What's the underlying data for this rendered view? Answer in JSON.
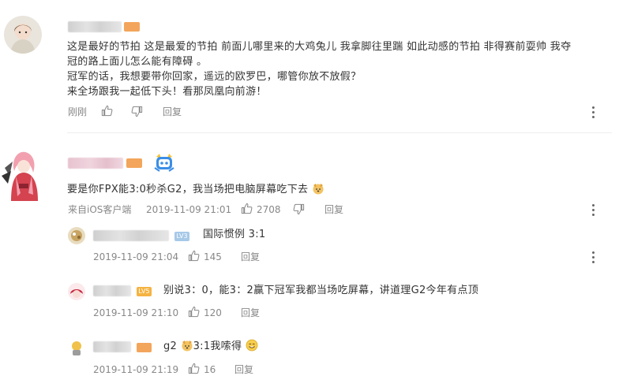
{
  "comments": [
    {
      "text_lines": [
        "这是最好的节拍 这是最爱的节拍 前面儿哪里来的大鸡兔儿 我拿脚往里踹 如此动感的节拍 非得赛前耍帅 我夺",
        "冠的路上面儿怎么能有障碍 。",
        "冠军的话，我想要带你回家，遥远的欧罗巴，哪管你放不放假？",
        "来全场跟我一起低下头！看那凤凰向前游！"
      ],
      "time": "刚刚",
      "like_count": "",
      "reply_label": "回复"
    },
    {
      "text": "要是你FPX能3:0秒杀G2，我当场把电脑屏幕吃下去",
      "source": "来自iOS客户端",
      "time": "2019-11-09 21:01",
      "like_count": "2708",
      "reply_label": "回复"
    }
  ],
  "replies": [
    {
      "badge": "LV3",
      "text": "国际惯例 3:1",
      "time": "2019-11-09 21:04",
      "like_count": "145",
      "reply_label": "回复"
    },
    {
      "badge": "LV5",
      "text": "别说3：0，能3：2赢下冠军我都当场吃屏幕，讲道理G2今年有点顶",
      "time": "2019-11-09 21:10",
      "like_count": "120",
      "reply_label": "回复"
    },
    {
      "badge": "",
      "text_a": "g2",
      "text_b": "3:1我嗦得",
      "time": "2019-11-09 21:19",
      "like_count": "16",
      "reply_label": "回复"
    }
  ],
  "icons": {
    "like": "thumbs-up-icon",
    "dislike": "thumbs-down-icon",
    "more": "more-vertical-icon",
    "dog": "dog-face-emoji",
    "smile": "smiling-face-emoji",
    "medal": "robot-medal-icon"
  },
  "colors": {
    "text": "#333333",
    "meta": "#888888",
    "badge_orange": "#f08a24",
    "badge_lv3": "#a7c9e8",
    "badge_lv5": "#f5b342"
  }
}
